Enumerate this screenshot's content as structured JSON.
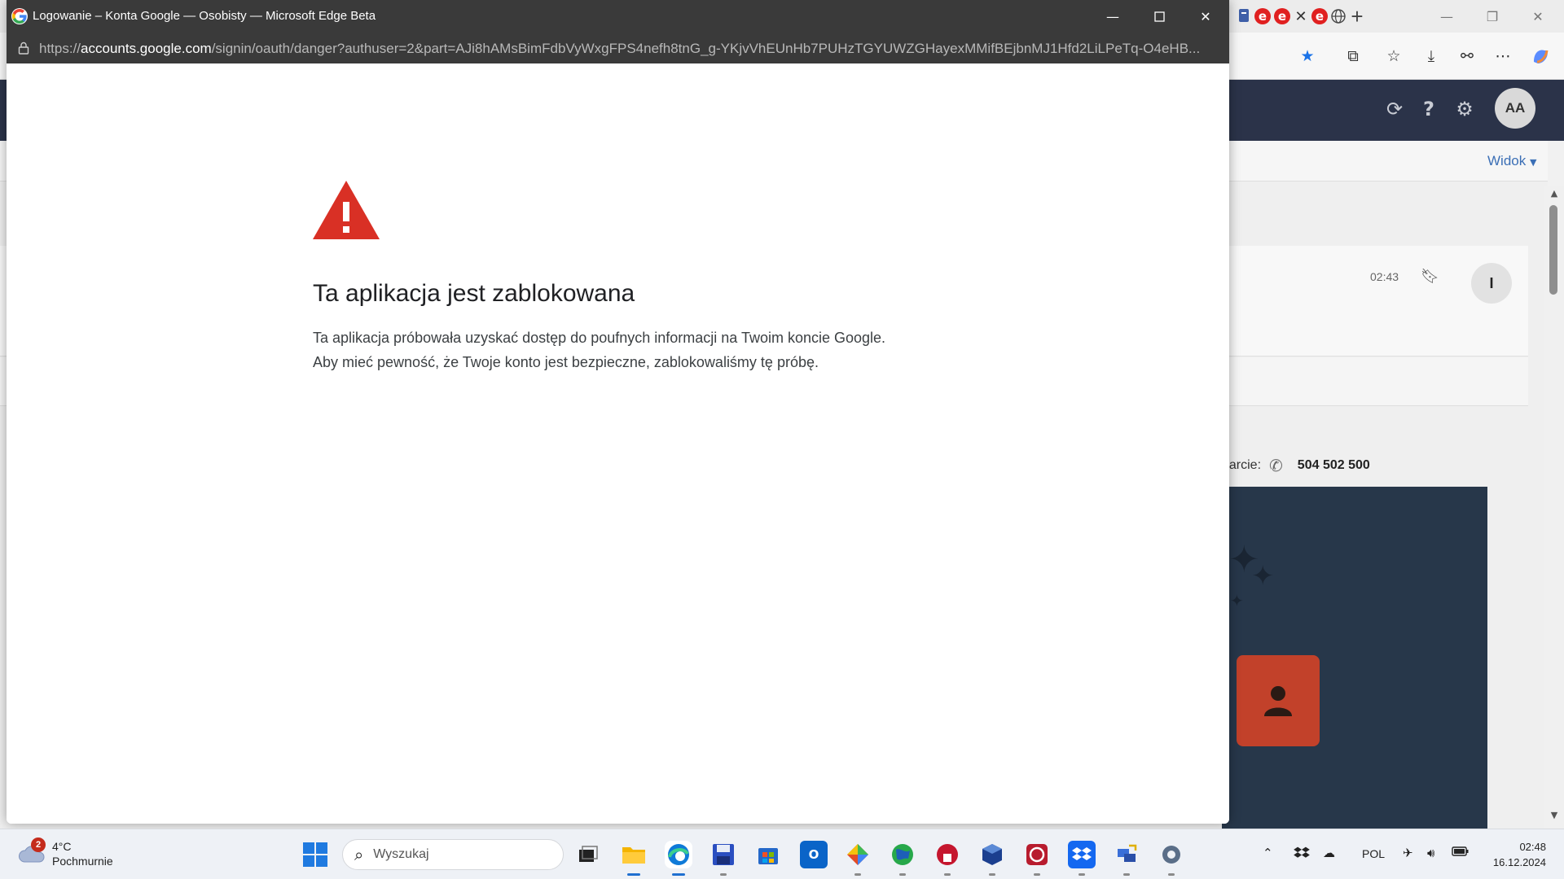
{
  "popup": {
    "window_title": "Logowanie – Konta Google — Osobisty — Microsoft Edge Beta",
    "url_prefix": "https://",
    "url_host": "accounts.google.com",
    "url_path": "/signin/oauth/danger?authuser=2&part=AJi8hAMsBimFdbVyWxgFPS4nefh8tnG_g-YKjvVhEUnHb7PUHzTGYUWZGHayexMMifBEjbnMJ1Hfd2LiLPeTq-O4eHB...",
    "heading": "Ta aplikacja jest zablokowana",
    "description_line1": "Ta aplikacja próbowała uzyskać dostęp do poufnych informacji na Twoim koncie Google.",
    "description_line2": "Aby mieć pewność, że Twoje konto jest bezpieczne, zablokowaliśmy tę próbę.",
    "warning_color": "#d93025"
  },
  "background_app": {
    "avatar_initials": "AA",
    "view_menu": "Widok",
    "message_time": "02:43",
    "sender_initial": "I",
    "support_label": "parcie:",
    "support_phone": "504 502 500"
  },
  "taskbar": {
    "weather_badge": "2",
    "weather_temp": "4°C",
    "weather_desc": "Pochmurnie",
    "search_placeholder": "Wyszukaj",
    "language": "POL",
    "time": "02:48",
    "date": "16.12.2024",
    "apps": [
      "task-view",
      "file-explorer",
      "edge",
      "floppy-save",
      "microsoft-store",
      "outlook",
      "git-tool",
      "earth-app",
      "red-app",
      "virtualbox",
      "media-app",
      "dropbox",
      "network-tool",
      "settings"
    ]
  }
}
